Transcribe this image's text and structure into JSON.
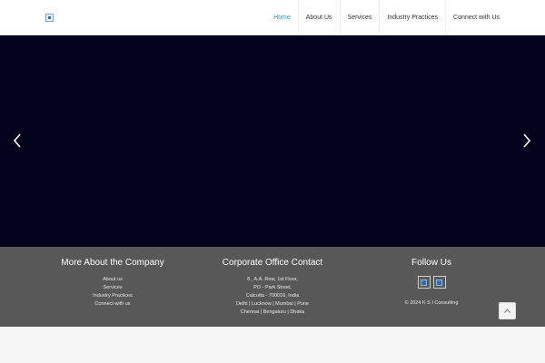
{
  "header": {
    "logo_icon": "company-logo",
    "nav": [
      "Home",
      "About Us",
      "Services",
      "Industry Practices",
      "Connect with Us"
    ],
    "active_index": 0,
    "accent_color": "#3a8fd8"
  },
  "slider": {
    "background": "#02021a",
    "prev_icon": "chevron-left-icon",
    "next_icon": "chevron-right-icon"
  },
  "footer": {
    "background": "#585858",
    "company": {
      "title": "More About the Company",
      "links": [
        "About us",
        "Services",
        "Industry Practices",
        "Connect with us"
      ]
    },
    "contact": {
      "title": "Corporate Office Contact",
      "lines": [
        "8 , A.A. Row, 1st Floor,",
        "PO - Park Street,",
        "Calcutta - 700016, India",
        "Delhi | Lucknow | Mumbai | Pune",
        "Chennai | Bengaluru | Dhaka"
      ]
    },
    "follow": {
      "title": "Follow Us",
      "icons": [
        "social-icon-1",
        "social-icon-2"
      ],
      "copyright": "© 2024 K S I Consulting"
    }
  },
  "scroll_top_icon": "chevron-up-icon"
}
